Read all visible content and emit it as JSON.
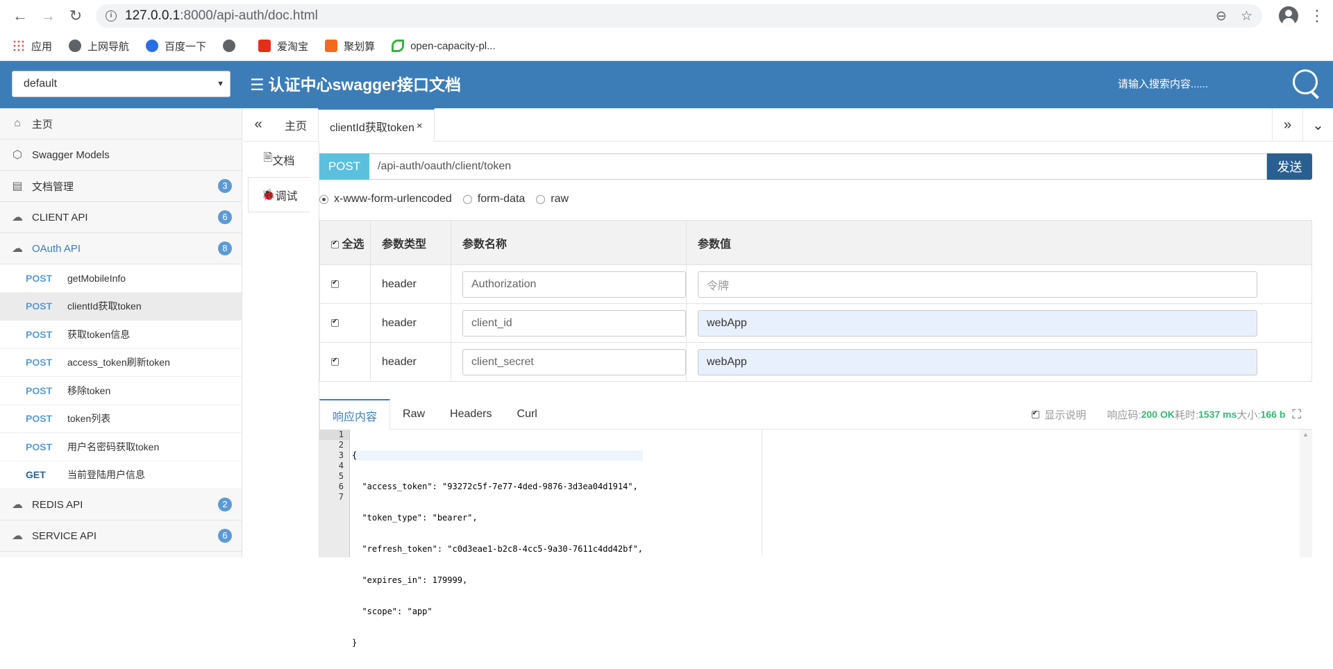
{
  "browser": {
    "url_host": "127.0.0.1",
    "url_path": ":8000/api-auth/doc.html",
    "bookmarks": [
      {
        "label": "应用",
        "icon": "apps-grid-icon"
      },
      {
        "label": "上网导航",
        "icon": "globe-icon"
      },
      {
        "label": "百度一下",
        "icon": "baidu-paw-icon"
      },
      {
        "label": "",
        "icon": "globe-icon"
      },
      {
        "label": "爱淘宝",
        "icon": "taobao-icon"
      },
      {
        "label": "聚划算",
        "icon": "juhuasuan-icon"
      },
      {
        "label": "open-capacity-pl...",
        "icon": "leaf-icon"
      }
    ]
  },
  "header": {
    "group_value": "default",
    "title": "认证中心swagger接口文档",
    "search_placeholder": "请输入搜索内容......"
  },
  "sidebar": {
    "items": [
      {
        "label": "主页",
        "icon": "home-icon"
      },
      {
        "label": "Swagger Models",
        "icon": "cube-icon"
      },
      {
        "label": "文档管理",
        "icon": "doc-settings-icon",
        "badge": "3"
      },
      {
        "label": "CLIENT API",
        "icon": "cloud-icon",
        "badge": "6"
      },
      {
        "label": "OAuth API",
        "icon": "cloud-icon",
        "badge": "8"
      }
    ],
    "oauth_endpoints": [
      {
        "method": "POST",
        "label": "getMobileInfo"
      },
      {
        "method": "POST",
        "label": "clientId获取token"
      },
      {
        "method": "POST",
        "label": "获取token信息"
      },
      {
        "method": "POST",
        "label": "access_token刷新token"
      },
      {
        "method": "POST",
        "label": "移除token"
      },
      {
        "method": "POST",
        "label": "token列表"
      },
      {
        "method": "POST",
        "label": "用户名密码获取token"
      },
      {
        "method": "GET",
        "label": "当前登陆用户信息"
      }
    ],
    "bottom_items": [
      {
        "label": "REDIS API",
        "icon": "cloud-icon",
        "badge": "2"
      },
      {
        "label": "SERVICE API",
        "icon": "cloud-icon",
        "badge": "6"
      }
    ]
  },
  "tabs": {
    "home": "主页",
    "active": "clientId获取token",
    "close": "×"
  },
  "side_tabs": {
    "doc": "文档",
    "debug": "调试"
  },
  "request": {
    "method": "POST",
    "url": "/api-auth/oauth/client/token",
    "send_label": "发送",
    "content_types": [
      "x-www-form-urlencoded",
      "form-data",
      "raw"
    ]
  },
  "params_table": {
    "headers": [
      "全选",
      "参数类型",
      "参数名称",
      "参数值"
    ],
    "rows": [
      {
        "type": "header",
        "name": "Authorization",
        "value": "",
        "placeholder": "令牌"
      },
      {
        "type": "header",
        "name": "client_id",
        "value": "webApp",
        "placeholder": ""
      },
      {
        "type": "header",
        "name": "client_secret",
        "value": "webApp",
        "placeholder": ""
      }
    ]
  },
  "response": {
    "tabs": [
      "响应内容",
      "Raw",
      "Headers",
      "Curl"
    ],
    "show_desc_label": "显示说明",
    "code_label": "响应码:",
    "code_value": "200 OK",
    "time_label": "耗时:",
    "time_value": "1537 ms",
    "size_label": "大小:",
    "size_value": "166 b",
    "body_lines": [
      "{",
      "  \"access_token\": \"93272c5f-7e77-4ded-9876-3d3ea04d1914\",",
      "  \"token_type\": \"bearer\",",
      "  \"refresh_token\": \"c0d3eae1-b2c8-4cc5-9a30-7611c4dd42bf\",",
      "  \"expires_in\": 179999,",
      "  \"scope\": \"app\"",
      "}"
    ],
    "line_numbers": [
      "1",
      "2",
      "3",
      "4",
      "5",
      "6",
      "7"
    ]
  }
}
